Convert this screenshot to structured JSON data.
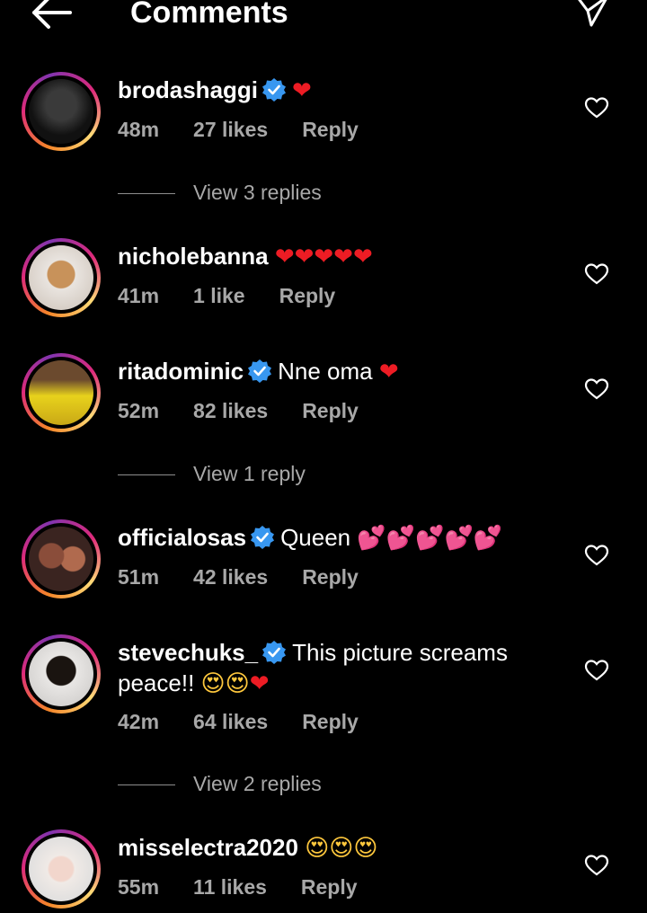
{
  "header": {
    "title": "Comments"
  },
  "comments": [
    {
      "username": "brodashaggi",
      "verified": true,
      "text": "❤",
      "time": "48m",
      "likes": "27 likes",
      "reply": "Reply",
      "view_replies": "View 3 replies"
    },
    {
      "username": "nicholebanna",
      "verified": false,
      "text": "❤❤❤❤❤",
      "time": "41m",
      "likes": "1 like",
      "reply": "Reply"
    },
    {
      "username": "ritadominic",
      "verified": true,
      "text": "Nne oma ",
      "emoji": "❤",
      "time": "52m",
      "likes": "82 likes",
      "reply": "Reply",
      "view_replies": "View 1 reply"
    },
    {
      "username": "officialosas",
      "verified": true,
      "text": "Queen ",
      "emoji": "💕💕💕💕💕",
      "time": "51m",
      "likes": "42 likes",
      "reply": "Reply"
    },
    {
      "username": "stevechuks_",
      "verified": true,
      "text": "This picture screams",
      "text2": "peace!! ",
      "emoji": "😍😍",
      "emoji2": "❤",
      "time": "42m",
      "likes": "64 likes",
      "reply": "Reply",
      "view_replies": "View 2 replies"
    },
    {
      "username": "misselectra2020",
      "verified": false,
      "text": "😍😍😍",
      "time": "55m",
      "likes": "11 likes",
      "reply": "Reply"
    }
  ],
  "colors": {
    "verified": "#3897f0",
    "meta": "#a8a8a8",
    "background": "#000000"
  },
  "icons": {
    "back": "arrow-left-icon",
    "send": "paper-plane-icon",
    "like": "heart-outline-icon",
    "verified": "verified-badge-icon"
  }
}
